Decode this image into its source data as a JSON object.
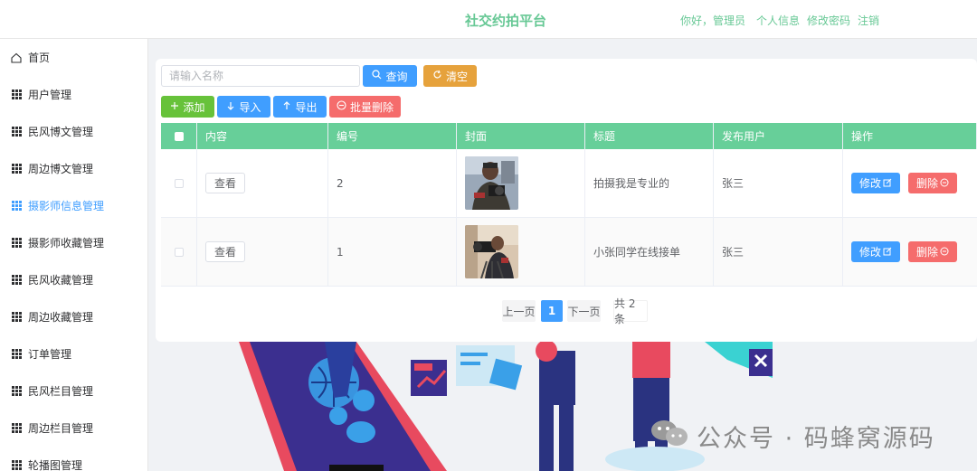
{
  "header": {
    "brand": "社交约拍平台",
    "greeting": "你好，管理员",
    "profile_link": "个人信息",
    "password_link": "修改密码",
    "logout_link": "注销"
  },
  "sidebar": {
    "items": [
      {
        "label": "首页",
        "icon": "home-icon"
      },
      {
        "label": "用户管理",
        "icon": "grid-icon"
      },
      {
        "label": "民风博文管理",
        "icon": "grid-icon"
      },
      {
        "label": "周边博文管理",
        "icon": "grid-icon"
      },
      {
        "label": "摄影师信息管理",
        "icon": "grid-icon",
        "active": true
      },
      {
        "label": "摄影师收藏管理",
        "icon": "grid-icon"
      },
      {
        "label": "民风收藏管理",
        "icon": "grid-icon"
      },
      {
        "label": "周边收藏管理",
        "icon": "grid-icon"
      },
      {
        "label": "订单管理",
        "icon": "grid-icon"
      },
      {
        "label": "民风栏目管理",
        "icon": "grid-icon"
      },
      {
        "label": "周边栏目管理",
        "icon": "grid-icon"
      },
      {
        "label": "轮播图管理",
        "icon": "grid-icon"
      }
    ]
  },
  "search": {
    "placeholder": "请输入名称",
    "query_label": "查询",
    "clear_label": "清空"
  },
  "toolbar": {
    "add_label": "添加",
    "import_label": "导入",
    "export_label": "导出",
    "batch_delete_label": "批量删除"
  },
  "table": {
    "headers": [
      "内容",
      "编号",
      "封面",
      "标题",
      "发布用户",
      "操作"
    ],
    "rows": [
      {
        "view_label": "查看",
        "id": "2",
        "title": "拍摄我是专业的",
        "user": "张三",
        "edit_label": "修改",
        "delete_label": "删除"
      },
      {
        "view_label": "查看",
        "id": "1",
        "title": "小张同学在线接单",
        "user": "张三",
        "edit_label": "修改",
        "delete_label": "删除"
      }
    ]
  },
  "pagination": {
    "prev_label": "上一页",
    "current_page": "1",
    "next_label": "下一页",
    "total_label": "共 2 条"
  },
  "watermark": {
    "text": "公众号 · 码蜂窝源码"
  },
  "colors": {
    "brand_green": "#67c895",
    "table_header": "#67cf99",
    "primary_blue": "#409eff",
    "danger_red": "#f56c6c",
    "warning_orange": "#e6a23c",
    "success_green": "#67c23a"
  }
}
